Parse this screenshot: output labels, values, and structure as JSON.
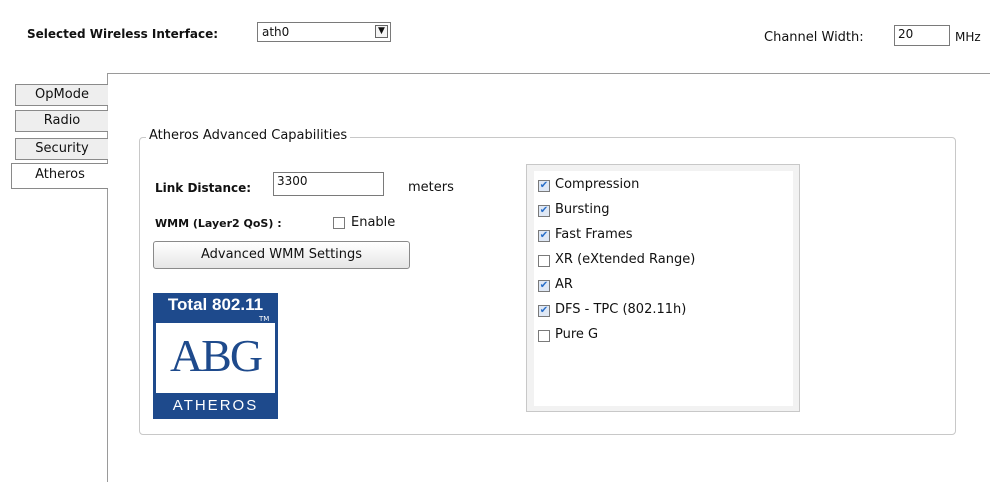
{
  "header": {
    "interface_label": "Selected Wireless Interface:",
    "interface_value": "ath0",
    "channel_width_label": "Channel Width:",
    "channel_width_value": "20",
    "channel_width_unit": "MHz"
  },
  "tabs": [
    {
      "label": "OpMode",
      "active": false
    },
    {
      "label": "Radio",
      "active": false
    },
    {
      "label": "Security",
      "active": false
    },
    {
      "label": "Atheros",
      "active": true
    }
  ],
  "group": {
    "title": "Atheros Advanced Capabilities",
    "link_distance_label": "Link Distance:",
    "link_distance_value": "3300",
    "link_distance_unit": "meters",
    "wmm_label": "WMM (Layer2 QoS) :",
    "wmm_enable_label": "Enable",
    "wmm_enabled": false,
    "advanced_wmm_button": "Advanced WMM Settings"
  },
  "capabilities": [
    {
      "label": "Compression",
      "checked": true
    },
    {
      "label": "Bursting",
      "checked": true
    },
    {
      "label": "Fast Frames",
      "checked": true
    },
    {
      "label": "XR (eXtended Range)",
      "checked": false
    },
    {
      "label": "AR",
      "checked": true
    },
    {
      "label": "DFS - TPC (802.11h)",
      "checked": true
    },
    {
      "label": "Pure G",
      "checked": false
    }
  ],
  "logo": {
    "top_text": "Total 802.11",
    "tm": "TM",
    "main_text": "ABG",
    "bottom_text": "ATHEROS"
  },
  "colors": {
    "logo_blue": "#1e4a8c",
    "check_blue": "#2a6fc9"
  }
}
